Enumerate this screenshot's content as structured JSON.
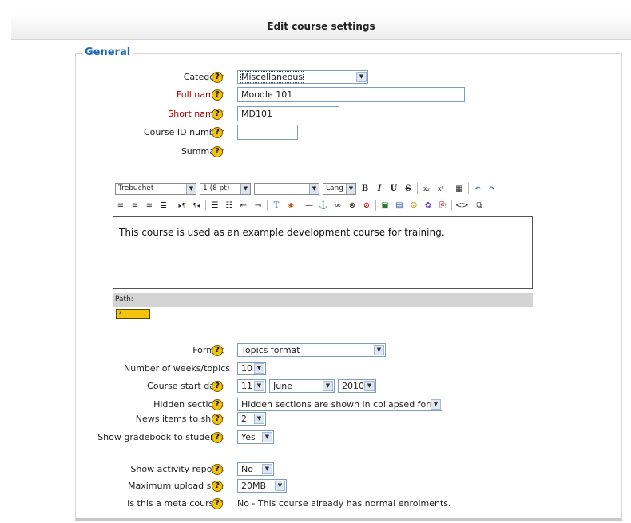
{
  "header": {
    "title": "Edit course settings"
  },
  "fieldset": {
    "legend": "General"
  },
  "help_glyph": "?",
  "required_mark": "*",
  "arrow_glyph": "▼",
  "fields": {
    "category": {
      "label": "Category",
      "value": "Miscellaneous"
    },
    "fullname": {
      "label": "Full name",
      "value": "Moodle 101"
    },
    "shortname": {
      "label": "Short name",
      "value": "MD101"
    },
    "idnumber": {
      "label": "Course ID number",
      "value": ""
    },
    "summary": {
      "label": "Summary"
    },
    "format": {
      "label": "Format",
      "value": "Topics format"
    },
    "numsections": {
      "label": "Number of weeks/topics",
      "value": "10"
    },
    "startdate": {
      "label": "Course start date",
      "day": "11",
      "month": "June",
      "year": "2010"
    },
    "hiddensections": {
      "label": "Hidden sections",
      "value": "Hidden sections are shown in collapsed form"
    },
    "newsitems": {
      "label": "News items to show",
      "value": "2"
    },
    "showgrades": {
      "label": "Show gradebook to students",
      "value": "Yes"
    },
    "showreports": {
      "label": "Show activity reports",
      "value": "No"
    },
    "maxbytes": {
      "label": "Maximum upload size",
      "value": "20MB"
    },
    "metacourse": {
      "label": "Is this a meta course?",
      "value": "No - This course already has normal enrolments."
    }
  },
  "editor": {
    "font": "Trebuchet",
    "size": "1 (8 pt)",
    "format": "",
    "lang": "Lang",
    "content": "This course is used as an example development course for training.",
    "path_label": "Path:",
    "kbd_label": "?"
  }
}
